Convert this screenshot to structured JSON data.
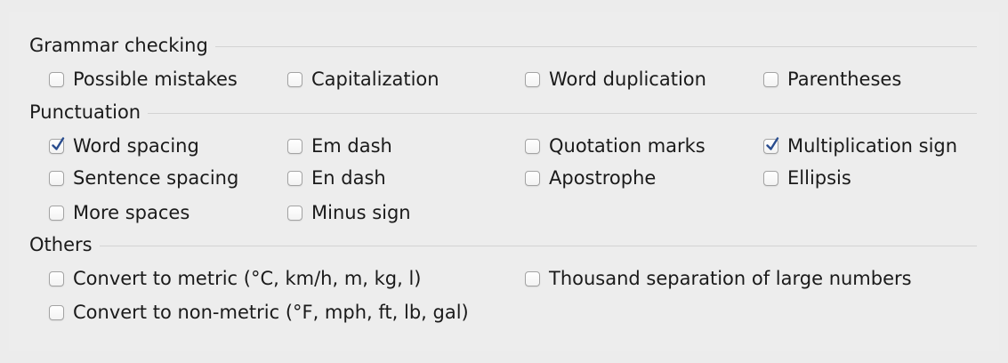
{
  "sections": {
    "grammar": {
      "title": "Grammar checking",
      "options": [
        {
          "label": "Possible mistakes",
          "checked": false
        },
        {
          "label": "Capitalization",
          "checked": false
        },
        {
          "label": "Word duplication",
          "checked": false
        },
        {
          "label": "Parentheses",
          "checked": false
        }
      ]
    },
    "punctuation": {
      "title": "Punctuation",
      "options": [
        {
          "label": "Word spacing",
          "checked": true
        },
        {
          "label": "Em dash",
          "checked": false
        },
        {
          "label": "Quotation marks",
          "checked": false
        },
        {
          "label": "Multiplication sign",
          "checked": true
        },
        {
          "label": "Sentence spacing",
          "checked": false
        },
        {
          "label": "En dash",
          "checked": false
        },
        {
          "label": "Apostrophe",
          "checked": false
        },
        {
          "label": "Ellipsis",
          "checked": false
        },
        {
          "label": "More spaces",
          "checked": false
        },
        {
          "label": "Minus sign",
          "checked": false
        }
      ]
    },
    "others": {
      "title": "Others",
      "options": [
        {
          "label": "Convert to metric (°C, km/h, m, kg, l)",
          "checked": false
        },
        {
          "label": "Thousand separation of large numbers",
          "checked": false
        },
        {
          "label": "Convert to non-metric (°F, mph, ft, lb, gal)",
          "checked": false
        }
      ]
    }
  },
  "colors": {
    "checkmark": "#2a4d8f",
    "background": "#ececec"
  }
}
